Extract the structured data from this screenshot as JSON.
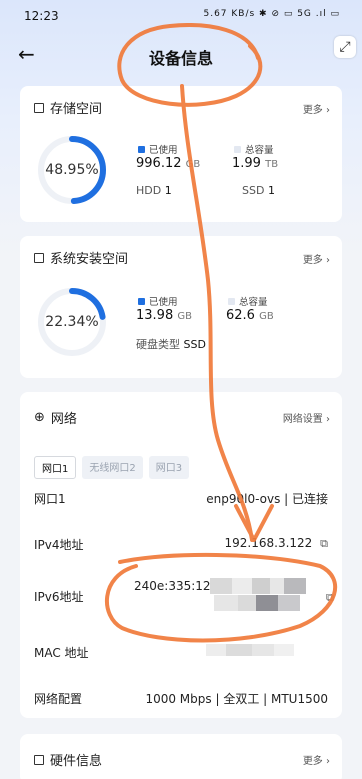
{
  "status": {
    "time": "12:23",
    "icons": "5.67 KB/s ✱ ⊘ ▭ 5G .ıl ▭"
  },
  "header": {
    "back": "←",
    "title": "设备信息"
  },
  "floating": {
    "icon": "⤢"
  },
  "storage": {
    "title": "存储空间",
    "more": "更多 ›",
    "percent": "48.95%",
    "percent_value": 0.4895,
    "used_label": "已使用",
    "used_value": "996.12",
    "used_unit": "GB",
    "total_label": "总容量",
    "total_value": "1.99",
    "total_unit": "TB",
    "hdd_label": "HDD",
    "hdd_count": "1",
    "ssd_label": "SSD",
    "ssd_count": "1"
  },
  "system": {
    "title": "系统安装空间",
    "more": "更多 ›",
    "percent": "22.34%",
    "percent_value": 0.2234,
    "used_label": "已使用",
    "used_value": "13.98",
    "used_unit": "GB",
    "total_label": "总容量",
    "total_value": "62.6",
    "total_unit": "GB",
    "disk_type_label": "硬盘类型",
    "disk_type": "SSD"
  },
  "network": {
    "title": "网络",
    "settings": "网络设置 ›",
    "tabs": [
      "网口1",
      "无线网口2",
      "网口3"
    ],
    "port_label": "网口1",
    "port_value": "enp90l0-ovs | 已连接",
    "ipv4_label": "IPv4地址",
    "ipv4_value": "192.168.3.122",
    "ipv6_label": "IPv6地址",
    "ipv6_value": "240e:335:120",
    "mac_label": "MAC 地址",
    "config_label": "网络配置",
    "config_value": "1000 Mbps | 全双工 | MTU1500"
  },
  "hardware": {
    "title": "硬件信息",
    "more": "更多 ›"
  },
  "colors": {
    "accent": "#1f6fe0",
    "track": "#eef1f6",
    "annotation": "#f07a3a"
  }
}
